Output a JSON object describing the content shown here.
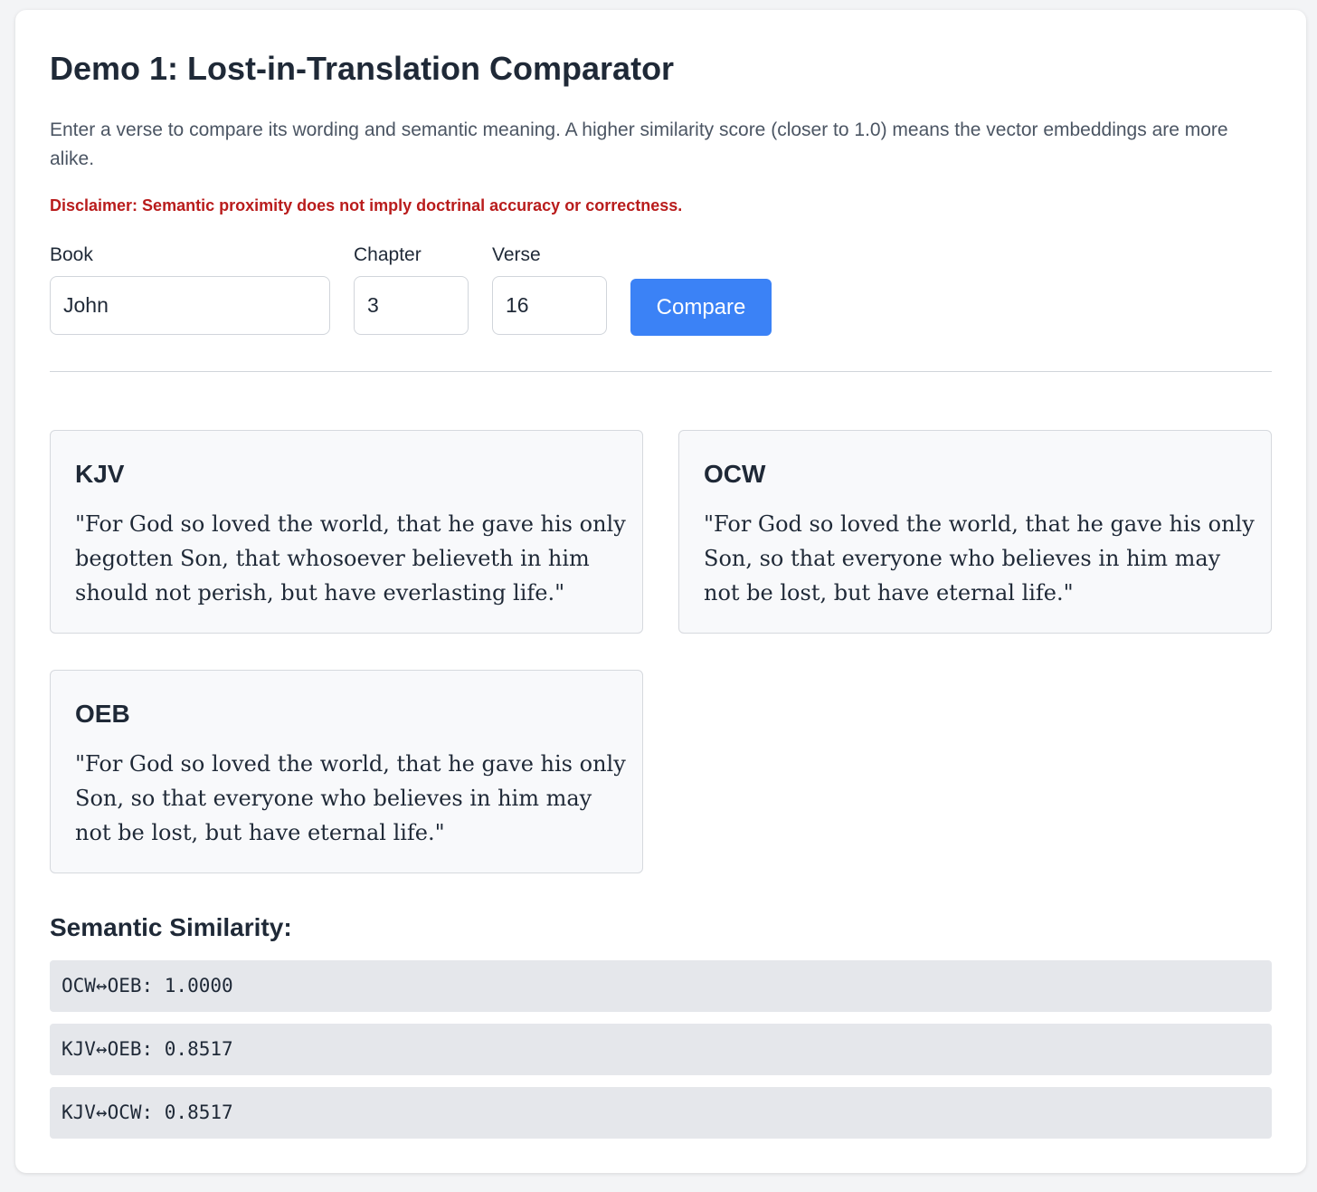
{
  "title": "Demo 1: Lost-in-Translation Comparator",
  "description": "Enter a verse to compare its wording and semantic meaning. A higher similarity score (closer to 1.0) means the vector embeddings are more alike.",
  "disclaimer": "Disclaimer: Semantic proximity does not imply doctrinal accuracy or correctness.",
  "form": {
    "book_label": "Book",
    "book_value": "John",
    "chapter_label": "Chapter",
    "chapter_value": "3",
    "verse_label": "Verse",
    "verse_value": "16",
    "compare_label": "Compare"
  },
  "translations": [
    {
      "name": "KJV",
      "text": "\"For God so loved the world, that he gave his only begotten Son, that whosoever believeth in him should not perish, but have everlasting life.\""
    },
    {
      "name": "OCW",
      "text": "\"For God so loved the world, that he gave his only Son, so that everyone who believes in him may not be lost, but have eternal life.\""
    },
    {
      "name": "OEB",
      "text": "\"For God so loved the world, that he gave his only Son, so that everyone who believes in him may not be lost, but have eternal life.\""
    }
  ],
  "similarity": {
    "heading": "Semantic Similarity:",
    "rows": [
      "OCW↔OEB: 1.0000",
      "KJV↔OEB: 0.8517",
      "KJV↔OCW: 0.8517"
    ]
  },
  "colors": {
    "accent": "#3b82f6",
    "disclaimer": "#b91c1c",
    "background": "#f3f4f6"
  }
}
